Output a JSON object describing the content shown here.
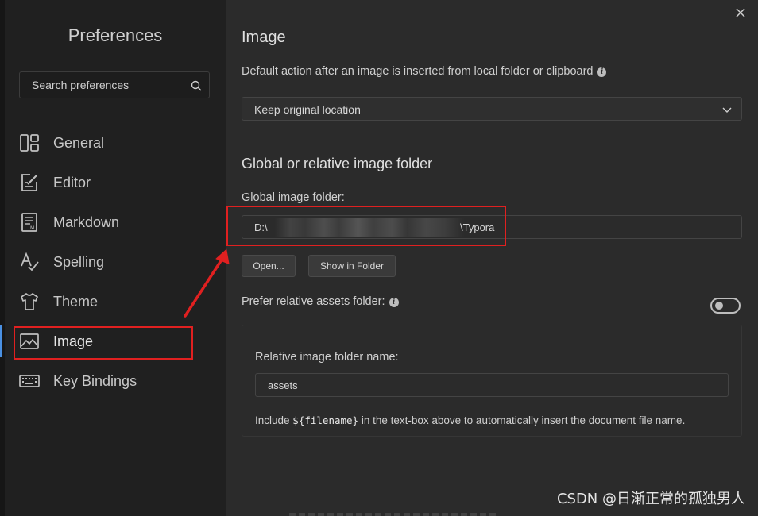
{
  "sidebar": {
    "title": "Preferences",
    "search_placeholder": "Search preferences",
    "items": [
      {
        "label": "General"
      },
      {
        "label": "Editor"
      },
      {
        "label": "Markdown"
      },
      {
        "label": "Spelling"
      },
      {
        "label": "Theme"
      },
      {
        "label": "Image"
      },
      {
        "label": "Key Bindings"
      }
    ]
  },
  "main": {
    "section_title": "Image",
    "insert_action_label": "Default action after an image is inserted from local folder or clipboard",
    "insert_action_value": "Keep original location",
    "folder_section_title": "Global or relative image folder",
    "global_folder_label": "Global image folder:",
    "global_folder_value": "D:\\",
    "global_folder_suffix": "\\Typora",
    "open_button": "Open...",
    "show_in_folder_button": "Show in Folder",
    "prefer_relative_label": "Prefer relative assets folder:",
    "relative_folder_label": "Relative image folder name:",
    "relative_folder_value": "assets",
    "hint_before": "Include ",
    "hint_code": "${filename}",
    "hint_after": " in the text-box above to automatically insert the document file name."
  },
  "watermark": "CSDN @日渐正常的孤独男人",
  "colors": {
    "highlight": "#e02020",
    "active_indicator": "#4a90e2"
  }
}
